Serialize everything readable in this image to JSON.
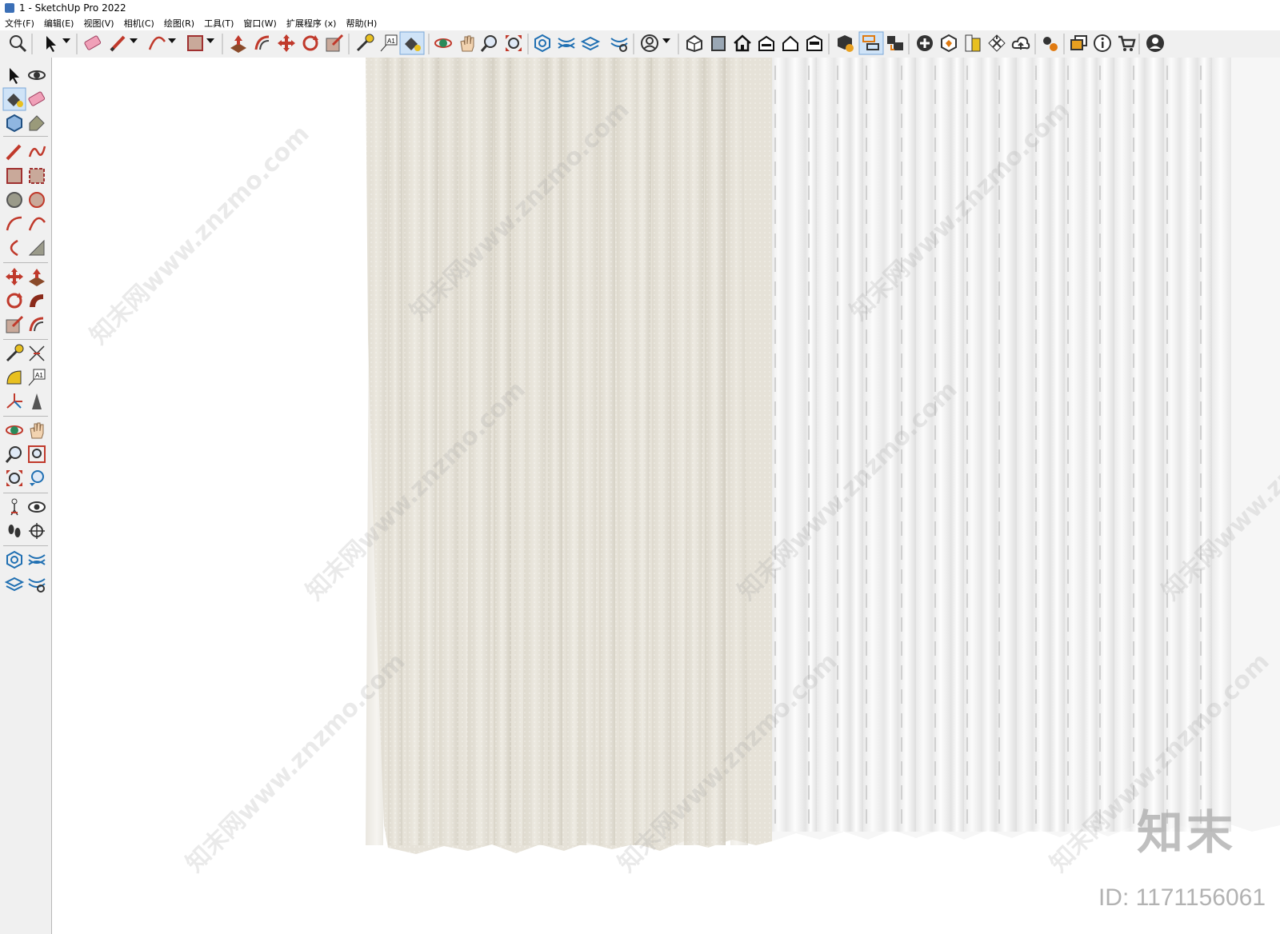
{
  "window": {
    "title": "1 - SketchUp Pro 2022"
  },
  "menu": [
    "文件(F)",
    "编辑(E)",
    "视图(V)",
    "相机(C)",
    "绘图(R)",
    "工具(T)",
    "窗口(W)",
    "扩展程序 (x)",
    "帮助(H)"
  ],
  "toolbar": {
    "icons": [
      "zoom-window-icon",
      "select-icon",
      "dropdown-arrow-icon",
      "eraser-icon",
      "pencil-line-icon",
      "dropdown-arrow-icon",
      "arc-icon",
      "dropdown-arrow-icon",
      "rectangle-icon",
      "dropdown-arrow-icon",
      "push-pull-icon",
      "offset-icon",
      "move-icon",
      "rotate-icon",
      "scale-icon",
      "tape-measure-icon",
      "text-icon",
      "paint-bucket-icon",
      "orbit-icon",
      "pan-icon",
      "zoom-icon",
      "zoom-extents-icon",
      "sandbox-icon",
      "sandbox-smoove-icon",
      "sandbox-stamp-icon",
      "sandbox-settings-icon",
      "account-icon",
      "dropdown-arrow-icon",
      "iso-view-icon",
      "front-view-icon",
      "home-view-icon",
      "right-view-icon",
      "back-view-icon",
      "left-view-icon",
      "entity-info-icon",
      "outliner-icon",
      "scenes-icon",
      "add-location-icon",
      "warehouse-icon",
      "materials-icon",
      "styles-icon",
      "cloud-icon",
      "extensions-icon",
      "layers-icon",
      "info-icon",
      "cart-icon",
      "user-icon"
    ]
  },
  "sidebar": {
    "icons": [
      "select-icon",
      "orbit-icon",
      "paint-bucket-icon",
      "eraser-icon",
      "make-component-icon",
      "tag-icon",
      "pencil-line-icon",
      "freehand-icon",
      "rectangle-icon",
      "rotated-rectangle-icon",
      "circle-icon",
      "polygon-icon",
      "arc-icon",
      "pie-icon",
      "two-point-arc-icon",
      "three-point-arc-icon",
      "move-icon",
      "push-pull-icon",
      "rotate-icon",
      "follow-me-icon",
      "scale-icon",
      "offset-icon",
      "tape-measure-icon",
      "dimension-icon",
      "protractor-icon",
      "text-icon",
      "axes-icon",
      "3d-text-icon",
      "orbit-icon",
      "pan-icon",
      "zoom-icon",
      "zoom-window-icon",
      "zoom-extents-icon",
      "previous-view-icon",
      "position-camera-icon",
      "look-around-icon",
      "walk-icon",
      "section-plane-icon",
      "sandbox-icon",
      "sandbox-smoove-icon",
      "sandbox-stamp-icon",
      "sandbox-settings-icon"
    ]
  },
  "watermark": {
    "text": "知末网www.znzmo.com",
    "brand": "知末",
    "id": "ID: 1171156061"
  },
  "colors": {
    "curtain_beige": "#e6e2d8",
    "curtain_white": "#f4f4f4",
    "accent": "#cfe3f7"
  }
}
